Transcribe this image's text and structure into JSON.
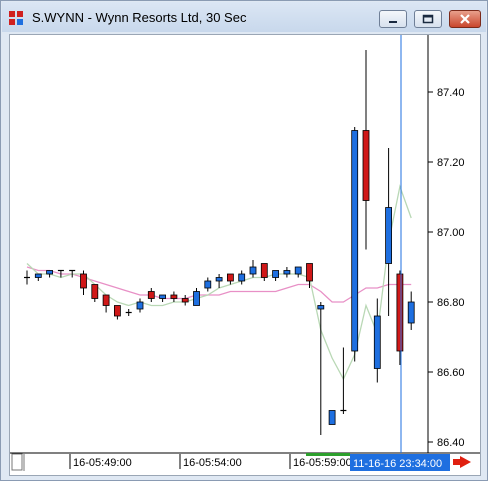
{
  "window": {
    "title": "S.WYNN - Wynn Resorts Ltd, 30 Sec",
    "minimize_icon": "minimize-icon",
    "restore_icon": "restore-icon",
    "close_icon": "close-icon"
  },
  "chart_data": {
    "type": "candlestick",
    "y_ticks": [
      "87.40",
      "87.20",
      "87.00",
      "86.80",
      "86.60",
      "86.40"
    ],
    "y_range": [
      86.38,
      87.55
    ],
    "x_ticks": [
      "16-05:49:00",
      "16-05:54:00",
      "16-05:59:00"
    ],
    "cursor_time": "11-16-16 23:34:00",
    "colors": {
      "up": "#1e6fe0",
      "down": "#d01818",
      "doji": "#000000",
      "ma_fast": "#b9d8b5",
      "ma_slow": "#e890c6",
      "cursor": "#1e6fe0",
      "scroll_arrow": "#e02010",
      "range_bar": "#2ca02c"
    },
    "candles": [
      {
        "o": 86.87,
        "h": 86.89,
        "l": 86.85,
        "c": 86.87
      },
      {
        "o": 86.87,
        "h": 86.88,
        "l": 86.86,
        "c": 86.88
      },
      {
        "o": 86.88,
        "h": 86.89,
        "l": 86.87,
        "c": 86.89
      },
      {
        "o": 86.89,
        "h": 86.89,
        "l": 86.87,
        "c": 86.89
      },
      {
        "o": 86.89,
        "h": 86.89,
        "l": 86.87,
        "c": 86.89
      },
      {
        "o": 86.88,
        "h": 86.89,
        "l": 86.82,
        "c": 86.84
      },
      {
        "o": 86.85,
        "h": 86.85,
        "l": 86.8,
        "c": 86.81
      },
      {
        "o": 86.82,
        "h": 86.82,
        "l": 86.77,
        "c": 86.79
      },
      {
        "o": 86.79,
        "h": 86.79,
        "l": 86.75,
        "c": 86.76
      },
      {
        "o": 86.77,
        "h": 86.78,
        "l": 86.76,
        "c": 86.77
      },
      {
        "o": 86.78,
        "h": 86.81,
        "l": 86.77,
        "c": 86.8
      },
      {
        "o": 86.83,
        "h": 86.84,
        "l": 86.8,
        "c": 86.81
      },
      {
        "o": 86.81,
        "h": 86.82,
        "l": 86.8,
        "c": 86.82
      },
      {
        "o": 86.82,
        "h": 86.83,
        "l": 86.8,
        "c": 86.81
      },
      {
        "o": 86.81,
        "h": 86.82,
        "l": 86.79,
        "c": 86.8
      },
      {
        "o": 86.79,
        "h": 86.84,
        "l": 86.79,
        "c": 86.83
      },
      {
        "o": 86.84,
        "h": 86.87,
        "l": 86.83,
        "c": 86.86
      },
      {
        "o": 86.86,
        "h": 86.88,
        "l": 86.84,
        "c": 86.87
      },
      {
        "o": 86.88,
        "h": 86.88,
        "l": 86.85,
        "c": 86.86
      },
      {
        "o": 86.86,
        "h": 86.89,
        "l": 86.85,
        "c": 86.88
      },
      {
        "o": 86.88,
        "h": 86.92,
        "l": 86.87,
        "c": 86.9
      },
      {
        "o": 86.91,
        "h": 86.91,
        "l": 86.86,
        "c": 86.87
      },
      {
        "o": 86.87,
        "h": 86.89,
        "l": 86.86,
        "c": 86.89
      },
      {
        "o": 86.88,
        "h": 86.9,
        "l": 86.87,
        "c": 86.89
      },
      {
        "o": 86.88,
        "h": 86.9,
        "l": 86.87,
        "c": 86.9
      },
      {
        "o": 86.91,
        "h": 86.91,
        "l": 86.84,
        "c": 86.86
      },
      {
        "o": 86.78,
        "h": 86.8,
        "l": 86.42,
        "c": 86.79
      },
      {
        "o": 86.45,
        "h": 86.49,
        "l": 86.45,
        "c": 86.49
      },
      {
        "o": 86.49,
        "h": 86.67,
        "l": 86.48,
        "c": 86.49
      },
      {
        "o": 86.66,
        "h": 87.3,
        "l": 86.63,
        "c": 87.29
      },
      {
        "o": 87.29,
        "h": 87.52,
        "l": 86.95,
        "c": 87.09
      },
      {
        "o": 86.61,
        "h": 86.81,
        "l": 86.57,
        "c": 86.76
      },
      {
        "o": 86.91,
        "h": 87.24,
        "l": 86.76,
        "c": 87.07
      },
      {
        "o": 86.88,
        "h": 86.89,
        "l": 86.62,
        "c": 86.66
      },
      {
        "o": 86.74,
        "h": 86.83,
        "l": 86.72,
        "c": 86.8
      }
    ],
    "ma_fast": [
      86.91,
      86.88,
      86.88,
      86.87,
      86.88,
      86.88,
      86.85,
      86.82,
      86.8,
      86.79,
      86.8,
      86.79,
      86.79,
      86.8,
      86.8,
      86.81,
      86.82,
      86.84,
      86.85,
      86.86,
      86.87,
      86.87,
      86.88,
      86.88,
      86.88,
      86.87,
      86.72,
      86.64,
      86.58,
      86.65,
      86.79,
      86.71,
      86.97,
      87.13,
      87.04
    ],
    "ma_slow": [
      86.9,
      86.89,
      86.89,
      86.88,
      86.88,
      86.87,
      86.86,
      86.85,
      86.84,
      86.83,
      86.82,
      86.82,
      86.81,
      86.81,
      86.81,
      86.82,
      86.82,
      86.82,
      86.83,
      86.83,
      86.83,
      86.83,
      86.83,
      86.84,
      86.85,
      86.85,
      86.83,
      86.8,
      86.8,
      86.82,
      86.84,
      86.84,
      86.85,
      86.85,
      86.85
    ]
  }
}
